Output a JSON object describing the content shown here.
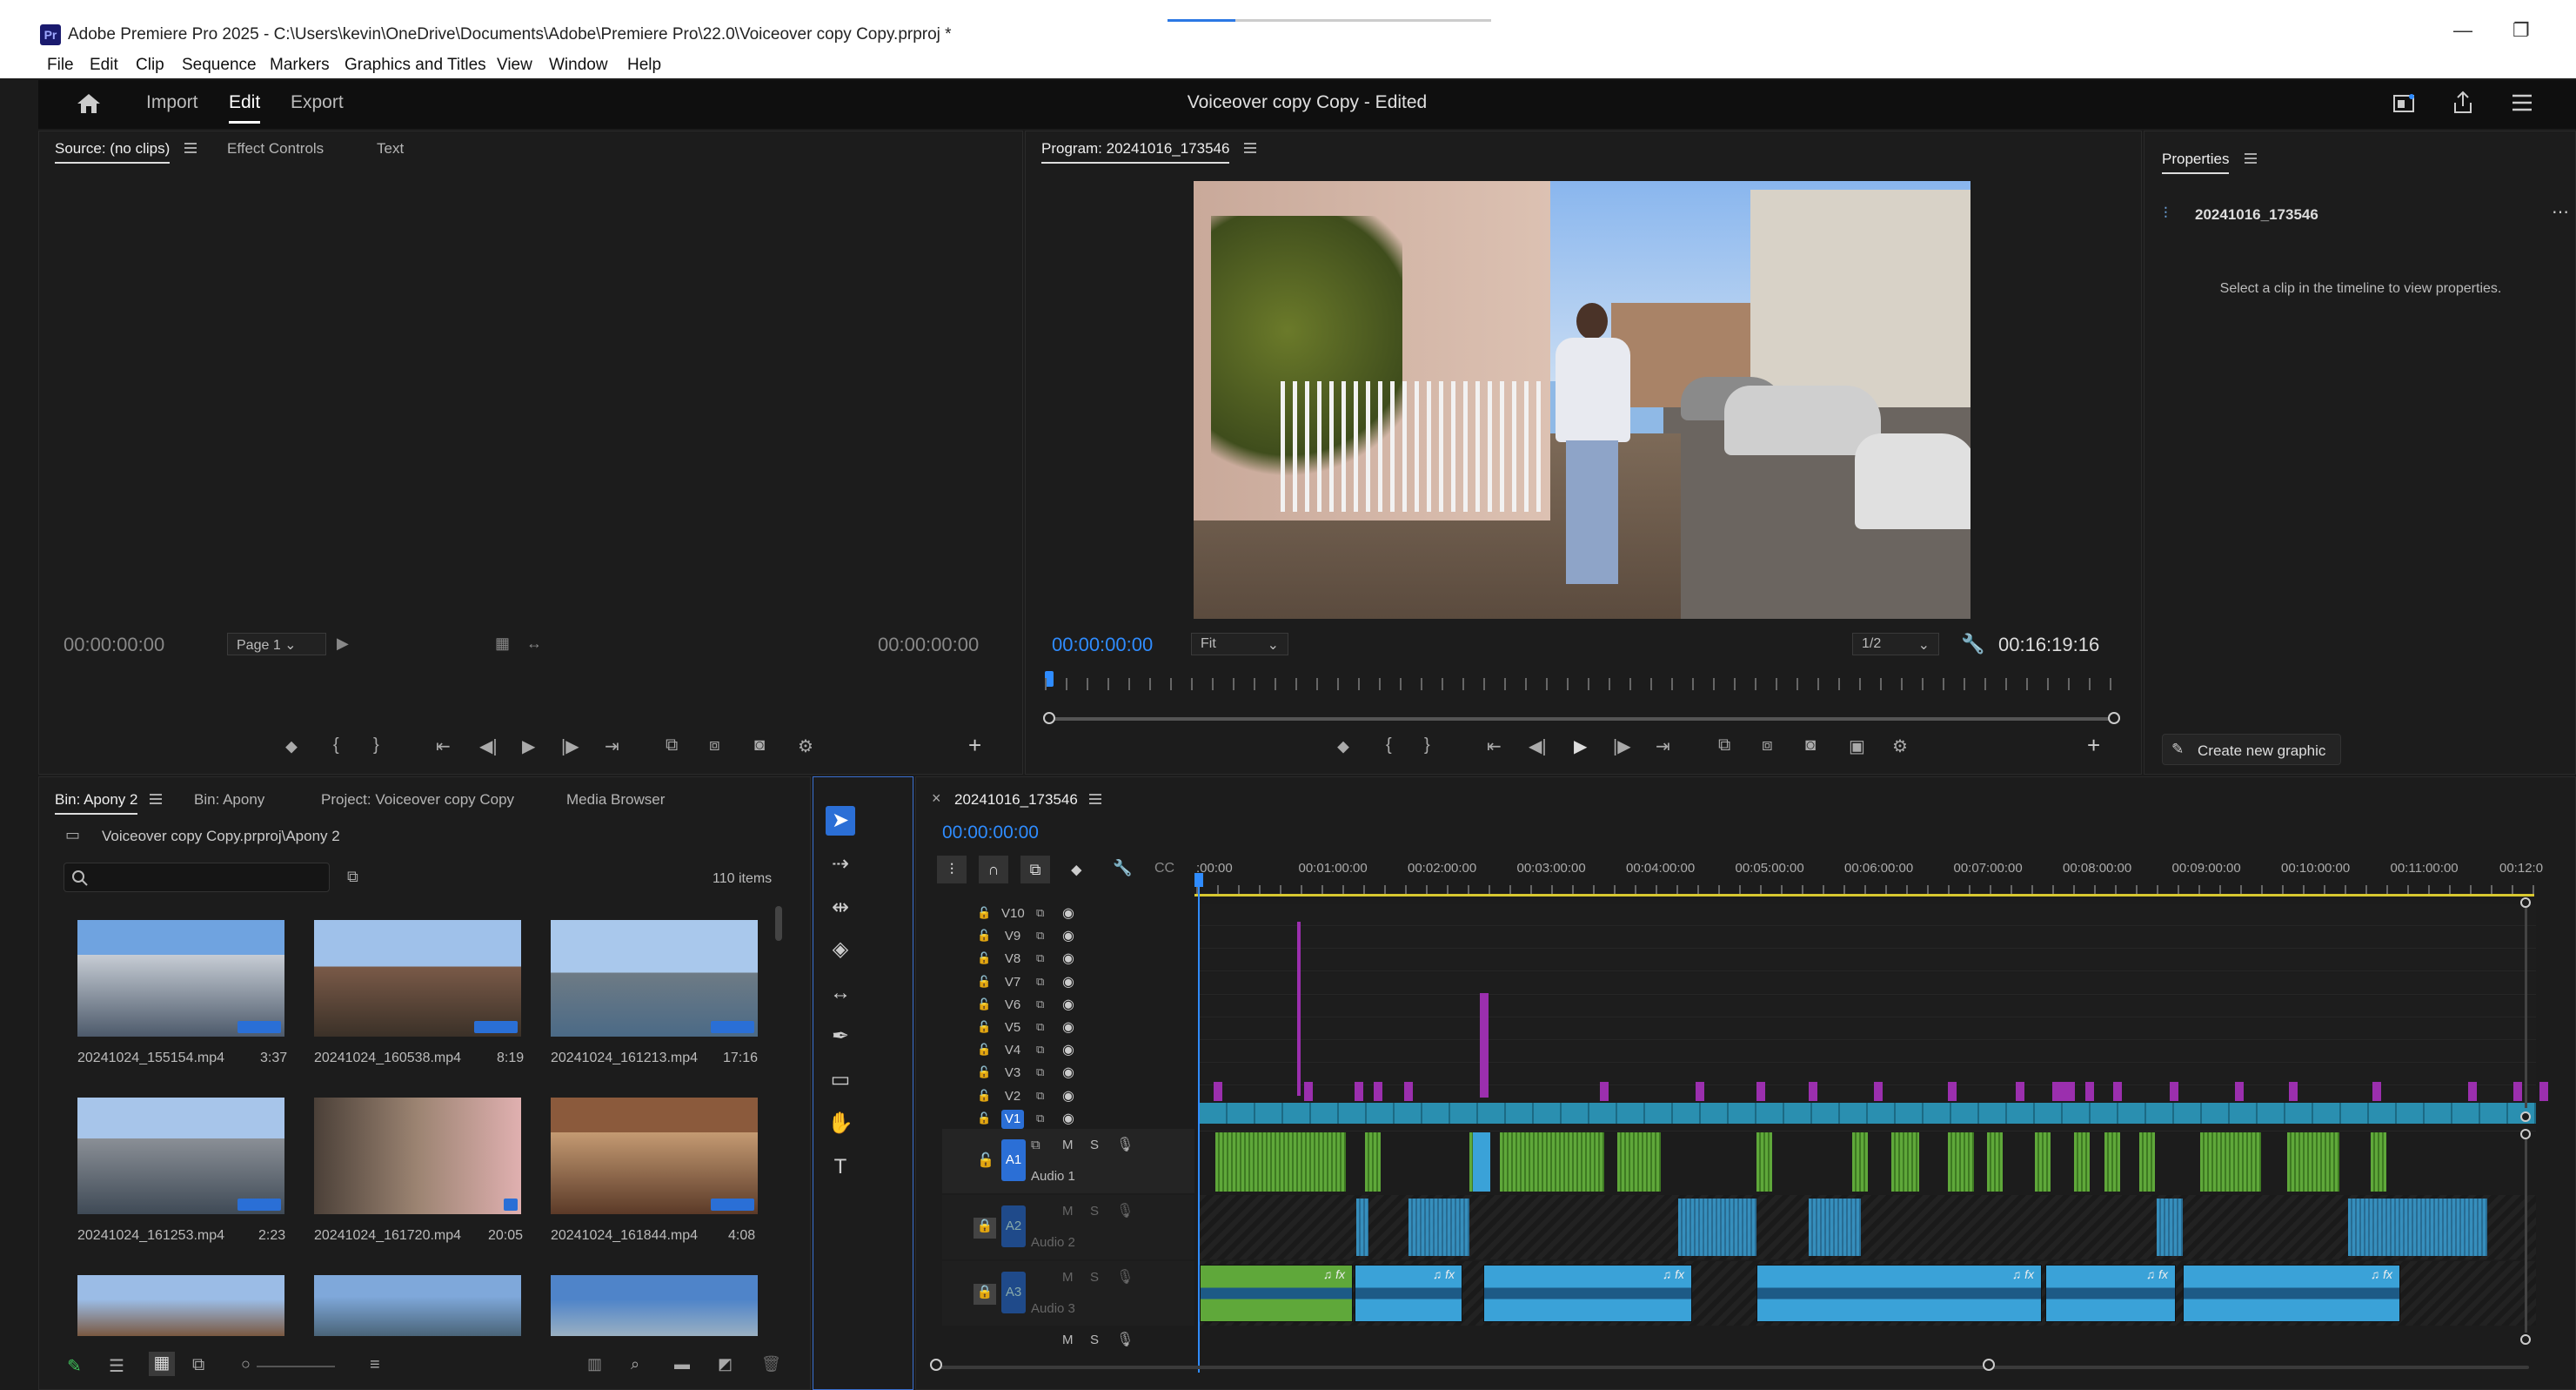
{
  "window": {
    "app_icon": "Pr",
    "title": "Adobe Premiere Pro 2025 - C:\\Users\\kevin\\OneDrive\\Documents\\Adobe\\Premiere Pro\\22.0\\Voiceover copy Copy.prproj *",
    "minimize": "—",
    "restore": "❐"
  },
  "menu": [
    "File",
    "Edit",
    "Clip",
    "Sequence",
    "Markers",
    "Graphics and Titles",
    "View",
    "Window",
    "Help"
  ],
  "workspace": {
    "tabs": [
      "Import",
      "Edit",
      "Export"
    ],
    "active_tab": "Edit",
    "project_title": "Voiceover copy Copy - Edited"
  },
  "source_panel": {
    "tabs": [
      "Source: (no clips)",
      "Effect Controls",
      "Text"
    ],
    "timecode_left": "00:00:00:00",
    "page_select": "Page 1",
    "timecode_right": "00:00:00:00"
  },
  "program_panel": {
    "title": "Program: 20241016_173546",
    "timecode": "00:00:00:00",
    "zoom_select": "Fit",
    "resolution_select": "1/2",
    "duration": "00:16:19:16"
  },
  "properties_panel": {
    "title": "Properties",
    "sequence_name": "20241016_173546",
    "hint": "Select a clip in the timeline to view properties.",
    "create_graphic": "Create new graphic"
  },
  "project_panel": {
    "tabs": [
      "Bin: Apony 2",
      "Bin: Apony",
      "Project: Voiceover copy Copy",
      "Media Browser"
    ],
    "path": "Voiceover copy Copy.prproj\\Apony 2",
    "search_placeholder": "",
    "item_count": "110 items",
    "items": [
      {
        "name": "20241024_155154.mp4",
        "duration": "3:37"
      },
      {
        "name": "20241024_160538.mp4",
        "duration": "8:19"
      },
      {
        "name": "20241024_161213.mp4",
        "duration": "17:16"
      },
      {
        "name": "20241024_161253.mp4",
        "duration": "2:23"
      },
      {
        "name": "20241024_161720.mp4",
        "duration": "20:05"
      },
      {
        "name": "20241024_161844.mp4",
        "duration": "4:08"
      }
    ]
  },
  "timeline": {
    "sequence_tab": "20241016_173546",
    "close": "×",
    "timecode": "00:00:00:00",
    "ruler": [
      ":00:00",
      "00:01:00:00",
      "00:02:00:00",
      "00:03:00:00",
      "00:04:00:00",
      "00:05:00:00",
      "00:06:00:00",
      "00:07:00:00",
      "00:08:00:00",
      "00:09:00:00",
      "00:10:00:00",
      "00:11:00:00",
      "00:12:0"
    ],
    "video_tracks": [
      "V10",
      "V9",
      "V8",
      "V7",
      "V6",
      "V5",
      "V4",
      "V3",
      "V2",
      "V1"
    ],
    "audio_tracks": [
      {
        "id": "A1",
        "name": "Audio 1"
      },
      {
        "id": "A2",
        "name": "Audio 2"
      },
      {
        "id": "A3",
        "name": "Audio 3"
      }
    ],
    "track_m": "M",
    "track_s": "S",
    "fx_label": "fx"
  },
  "colors": {
    "accent_blue": "#2f8cff",
    "video_clip": "#2a8fb0",
    "audio_green": "#5fa83a",
    "audio_blue": "#3aa2d8",
    "marker_purple": "#9b2fae",
    "work_area": "#d8c830"
  }
}
